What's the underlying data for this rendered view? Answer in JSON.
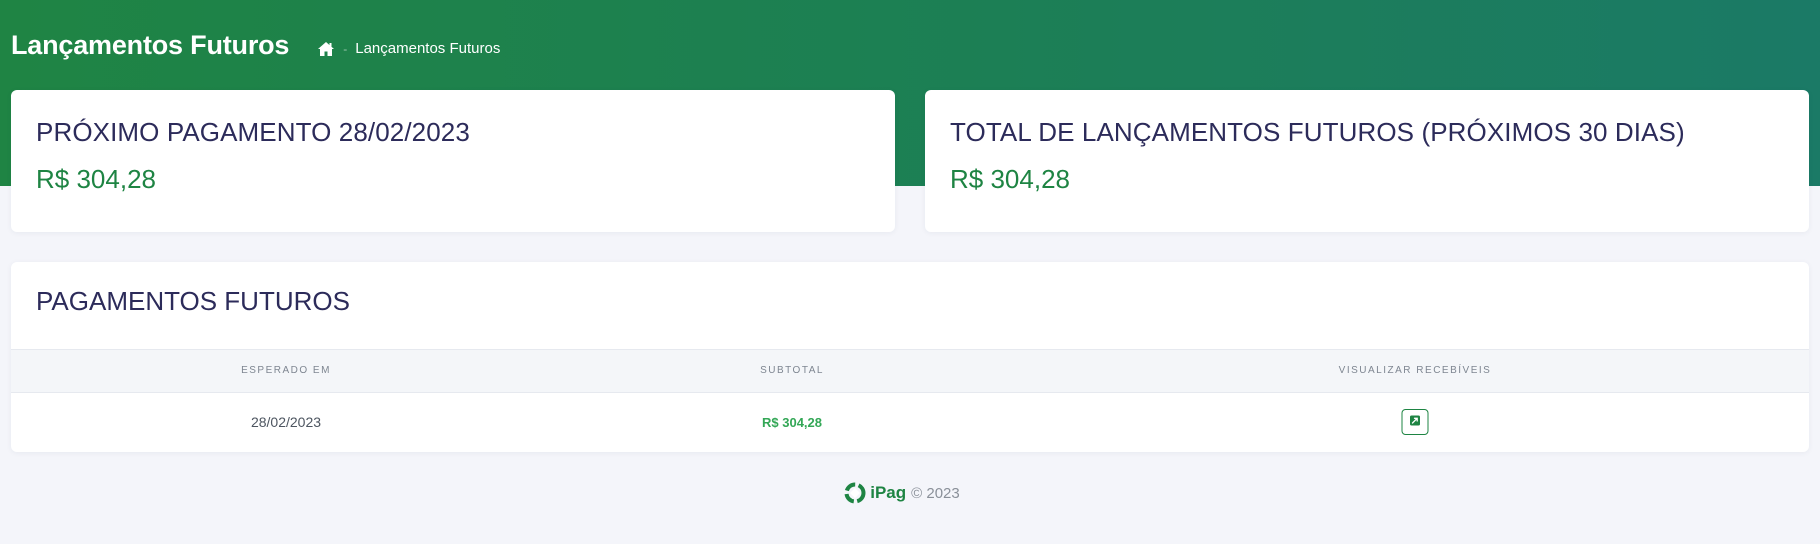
{
  "header": {
    "title": "Lançamentos Futuros",
    "breadcrumb": {
      "home_icon": "home-icon",
      "separator": "-",
      "current": "Lançamentos Futuros"
    }
  },
  "summary_cards": [
    {
      "label": "PRÓXIMO PAGAMENTO 28/02/2023",
      "value": "R$ 304,28"
    },
    {
      "label": "TOTAL DE LANÇAMENTOS FUTUROS (PRÓXIMOS 30 DIAS)",
      "value": "R$ 304,28"
    }
  ],
  "payments": {
    "title": "PAGAMENTOS FUTUROS",
    "columns": [
      "ESPERADO EM",
      "SUBTOTAL",
      "VISUALIZAR RECEBÍVEIS"
    ],
    "rows": [
      {
        "expected_on": "28/02/2023",
        "subtotal": "R$ 304,28",
        "action_icon": "external-link-icon"
      }
    ]
  },
  "footer": {
    "logo_text": "iPag",
    "copyright": "© 2023"
  },
  "colors": {
    "brand_green": "#1e8443",
    "subtotal_green": "#33a756",
    "heading_navy": "#2c2b5a",
    "page_background": "#f4f5fa"
  }
}
